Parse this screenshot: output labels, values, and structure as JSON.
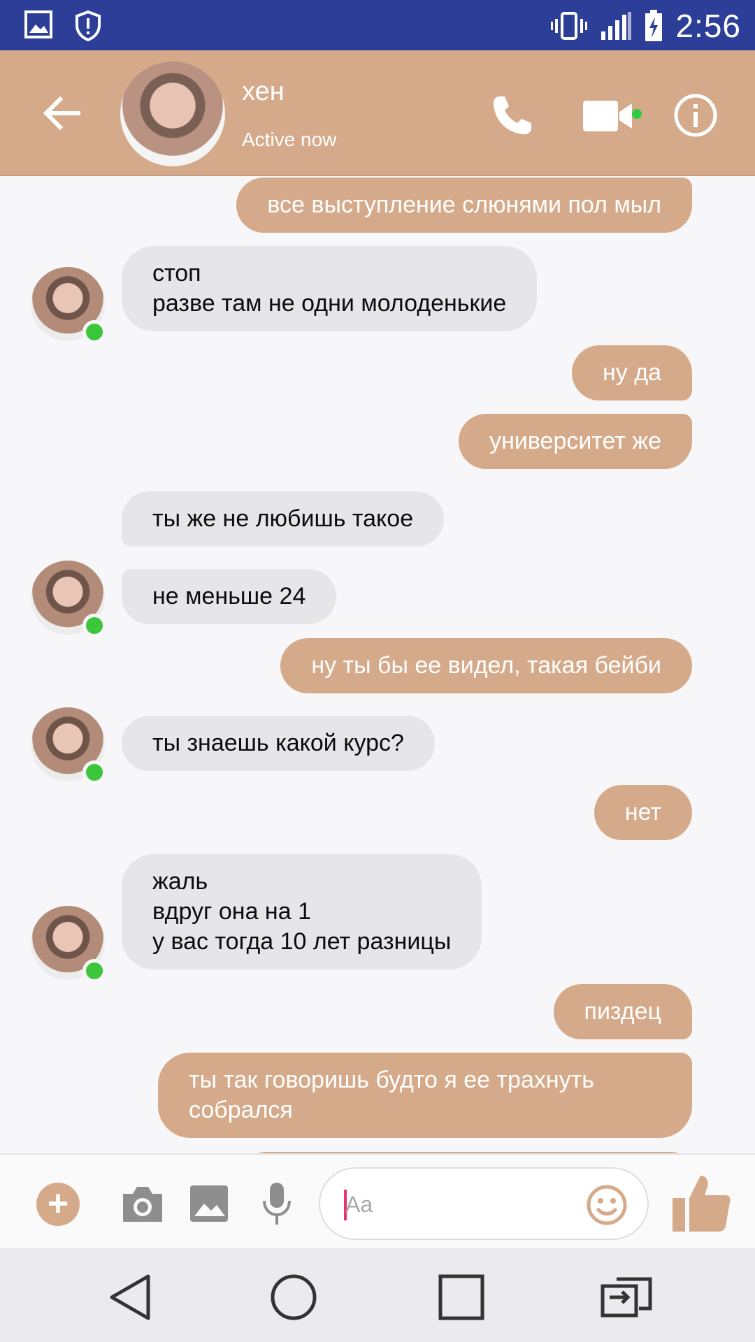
{
  "status_bar": {
    "time": "2:56",
    "icons": [
      "gallery-icon",
      "shield-icon",
      "vibrate-icon",
      "signal-icon",
      "battery-charging-icon"
    ]
  },
  "header": {
    "contact_name": "хен",
    "contact_status": "Active now",
    "icons": [
      "back-arrow-icon",
      "phone-icon",
      "video-camera-icon",
      "info-icon"
    ],
    "accent_color": "#d5aa8a",
    "online_color": "#2ecc40"
  },
  "messages": [
    {
      "dir": "out",
      "text": "все выступление слюнями пол мыл"
    },
    {
      "dir": "in",
      "text": "стоп\nразве там не одни молоденькие",
      "avatar": true
    },
    {
      "dir": "out",
      "text": "ну да"
    },
    {
      "dir": "out",
      "text": "университет же"
    },
    {
      "dir": "in",
      "text": "ты же не любишь такое"
    },
    {
      "dir": "in",
      "text": "не меньше 24",
      "avatar": true
    },
    {
      "dir": "out",
      "text": "ну ты бы ее видел, такая бейби"
    },
    {
      "dir": "in",
      "text": "ты знаешь какой курс?",
      "avatar": true
    },
    {
      "dir": "out",
      "text": "нет"
    },
    {
      "dir": "in",
      "text": "жаль\nвдруг она на 1\nу вас тогда 10 лет разницы",
      "avatar": true
    },
    {
      "dir": "out",
      "text": "пиздец"
    },
    {
      "dir": "out",
      "text": "ты так говоришь будто я ее трахнуть\nсобрался"
    }
  ],
  "composer": {
    "placeholder": "Aa",
    "value": "",
    "icons": [
      "plus-icon",
      "camera-icon",
      "image-icon",
      "microphone-icon",
      "emoji-icon",
      "thumbs-up-icon"
    ],
    "plus_label": "+"
  },
  "nav_bar": {
    "icons": [
      "back-triangle-icon",
      "home-circle-icon",
      "recents-square-icon",
      "screen-switch-icon"
    ]
  }
}
